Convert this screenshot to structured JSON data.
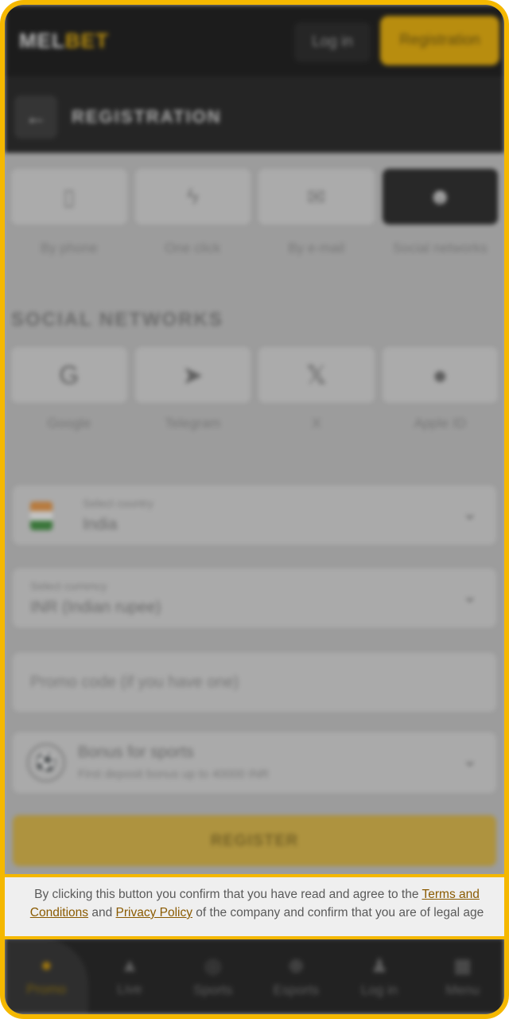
{
  "header": {
    "logo_main": "MEL",
    "logo_accent": "BET",
    "login_label": "Log in",
    "registration_label": "Registration"
  },
  "subheader": {
    "title": "REGISTRATION"
  },
  "registration_methods": [
    {
      "label": "By phone"
    },
    {
      "label": "One click"
    },
    {
      "label": "By e-mail"
    },
    {
      "label": "Social networks"
    }
  ],
  "social": {
    "title": "SOCIAL NETWORKS",
    "items": [
      {
        "label": "Google"
      },
      {
        "label": "Telegram"
      },
      {
        "label": "X"
      },
      {
        "label": "Apple ID"
      }
    ]
  },
  "country": {
    "label": "Select country",
    "value": "India"
  },
  "currency": {
    "label": "Select currency",
    "value": "INR (Indian rupee)"
  },
  "promo": {
    "placeholder": "Promo code (if you have one)"
  },
  "bonus": {
    "title": "Bonus for sports",
    "subtitle": "First deposit bonus up to 40000 INR"
  },
  "register_button": "REGISTER",
  "consent": {
    "text_1": "By clicking this button you confirm that you have read and agree to the ",
    "terms_link": "Terms and Conditions",
    "text_2": " and ",
    "privacy_link": "Privacy Policy",
    "text_3": " of the company and confirm that you are of legal age"
  },
  "bottom_nav": [
    {
      "label": "Promo"
    },
    {
      "label": "Live"
    },
    {
      "label": "Sports"
    },
    {
      "label": "Esports"
    },
    {
      "label": "Log in"
    },
    {
      "label": "Menu"
    }
  ],
  "colors": {
    "accent": "#f5b800",
    "link": "#8a5a00"
  }
}
